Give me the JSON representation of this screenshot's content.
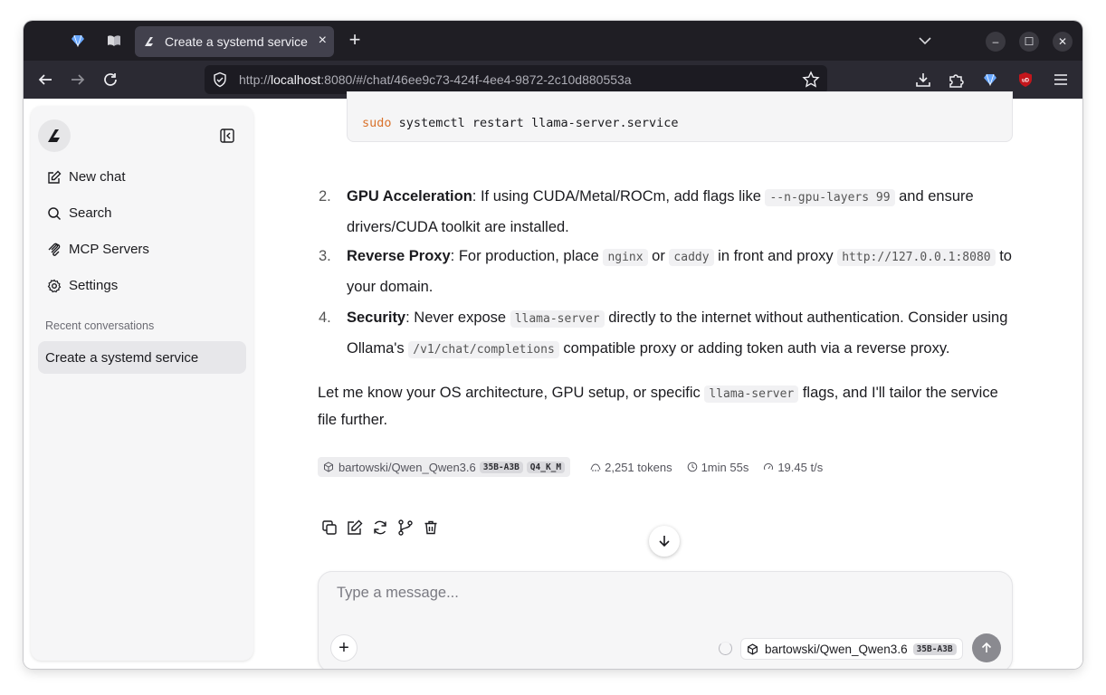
{
  "browser": {
    "tab_title": "Create a systemd service",
    "url_prefix": "http://",
    "url_host": "localhost",
    "url_rest": ":8080/#/chat/46ee9c73-424f-4ee4-9872-2c10d880553a"
  },
  "sidebar": {
    "items": [
      {
        "label": "New chat",
        "icon": "edit-icon"
      },
      {
        "label": "Search",
        "icon": "search-icon"
      },
      {
        "label": "MCP Servers",
        "icon": "mcp-icon"
      },
      {
        "label": "Settings",
        "icon": "gear-icon"
      }
    ],
    "recent_label": "Recent conversations",
    "recent": [
      "Create a systemd service"
    ]
  },
  "chat": {
    "code_keyword": "sudo",
    "code_rest": " systemctl restart llama-server.service",
    "steps": [
      {
        "num": "2.",
        "title": "GPU Acceleration",
        "t1": ": If using CUDA/Metal/ROCm, add flags like ",
        "c1": "--n-gpu-layers 99",
        "t2": " and ensure drivers/CUDA toolkit are installed."
      },
      {
        "num": "3.",
        "title": "Reverse Proxy",
        "t1": ": For production, place ",
        "c1": "nginx",
        "t2": " or ",
        "c2": "caddy",
        "t3": " in front and proxy ",
        "c3": "http://127.0.0.1:8080",
        "t4": " to your domain."
      },
      {
        "num": "4.",
        "title": "Security",
        "t1": ": Never expose ",
        "c1": "llama-server",
        "t2": " directly to the internet without authentication. Consider using Ollama's ",
        "c2": "/v1/chat/completions",
        "t3": " compatible proxy or adding token auth via a reverse proxy."
      }
    ],
    "closing_t1": "Let me know your OS architecture, GPU setup, or specific ",
    "closing_code": "llama-server",
    "closing_t2": " flags, and I'll tailor the service file further.",
    "meta": {
      "model": "bartowski/Qwen_Qwen3.6",
      "badge_size": "35B-A3B",
      "badge_quant": "Q4_K_M",
      "tokens": "2,251 tokens",
      "duration": "1min 55s",
      "speed": "19.45 t/s"
    }
  },
  "composer": {
    "placeholder": "Type a message...",
    "model": "bartowski/Qwen_Qwen3.6",
    "model_badge": "35B-A3B"
  },
  "colors": {
    "accent_code_keyword": "#d9722b",
    "tab_strip": "#1f1e24",
    "nav_bar": "#2b2a33"
  }
}
